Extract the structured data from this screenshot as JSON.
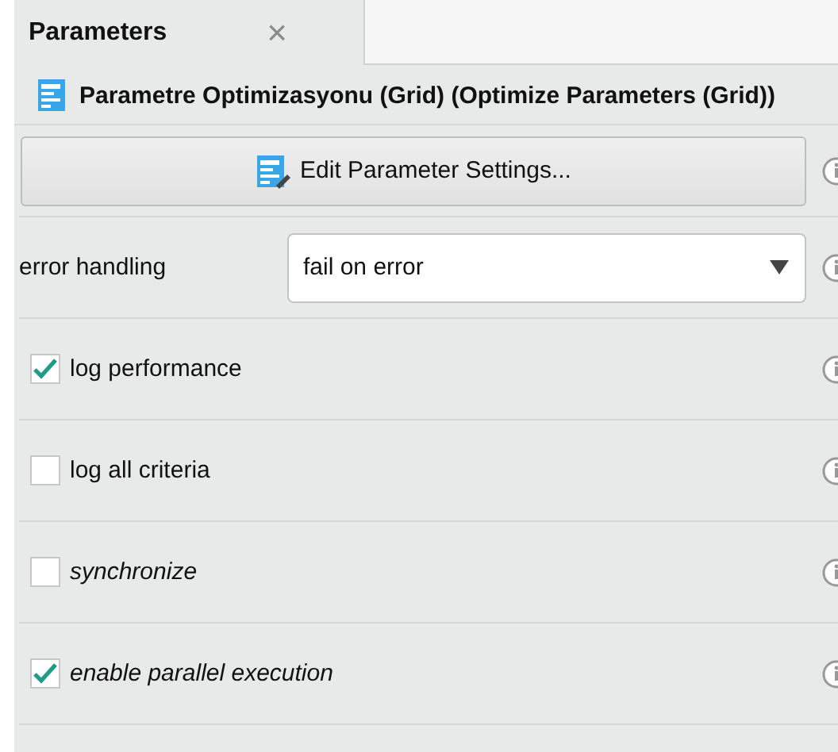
{
  "tabs": [
    {
      "label": "Parameters",
      "selected": true,
      "close": "×"
    }
  ],
  "operator": {
    "title": "Parametre Optimizasyonu (Grid) (Optimize Parameters (Grid))"
  },
  "edit_button": {
    "label": "Edit Parameter Settings..."
  },
  "params": [
    {
      "kind": "select",
      "label": "error handling",
      "value": "fail on error"
    },
    {
      "kind": "checkbox",
      "label": "log performance",
      "checked": true,
      "expert": false
    },
    {
      "kind": "checkbox",
      "label": "log all criteria",
      "checked": false,
      "expert": false
    },
    {
      "kind": "checkbox",
      "label": "synchronize",
      "checked": false,
      "expert": true
    },
    {
      "kind": "checkbox",
      "label": "enable parallel execution",
      "checked": true,
      "expert": true
    }
  ]
}
